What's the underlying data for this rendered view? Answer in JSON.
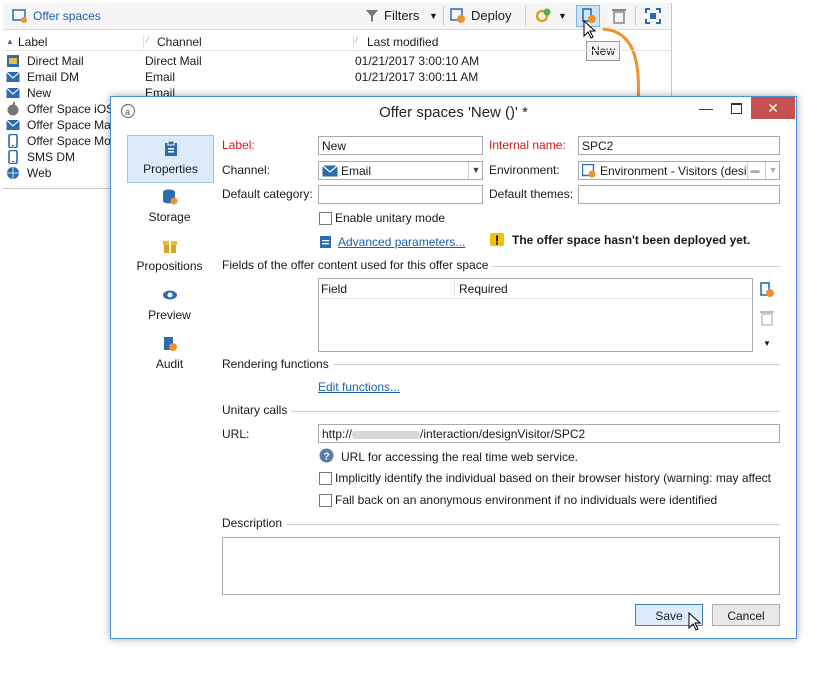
{
  "toolbar": {
    "title": "Offer spaces",
    "filters_label": "Filters",
    "deploy_label": "Deploy",
    "tooltip_new": "New"
  },
  "list": {
    "columns": [
      "Label",
      "Channel",
      "Last modified"
    ],
    "rows": [
      {
        "label": "Direct Mail",
        "channel": "Direct Mail",
        "modified": "01/21/2017 3:00:10 AM",
        "icon": "direct-mail-icon"
      },
      {
        "label": "Email DM",
        "channel": "Email",
        "modified": "01/21/2017 3:00:11 AM",
        "icon": "email-icon"
      },
      {
        "label": "New",
        "channel": "Email",
        "modified": "",
        "icon": "email-icon"
      },
      {
        "label": "Offer Space iOS",
        "channel": "",
        "modified": "",
        "icon": "apple-icon"
      },
      {
        "label": "Offer Space Mai",
        "channel": "",
        "modified": "",
        "icon": "email-icon"
      },
      {
        "label": "Offer Space Mo",
        "channel": "",
        "modified": "",
        "icon": "mobile-icon"
      },
      {
        "label": "SMS DM",
        "channel": "",
        "modified": "",
        "icon": "mobile-icon"
      },
      {
        "label": "Web",
        "channel": "",
        "modified": "",
        "icon": "globe-icon"
      }
    ]
  },
  "dialog": {
    "title": "Offer spaces 'New ()' *",
    "nav": [
      "Properties",
      "Storage",
      "Propositions",
      "Preview",
      "Audit"
    ],
    "label_label": "Label:",
    "label_value": "New",
    "internal_name_label": "Internal name:",
    "internal_name_value": "SPC2",
    "channel_label": "Channel:",
    "channel_value": "Email",
    "environment_label": "Environment:",
    "environment_value": "Environment - Visitors (desi",
    "default_category_label": "Default category:",
    "default_category_value": "",
    "default_themes_label": "Default themes:",
    "default_themes_value": "",
    "unitary_mode_label": "Enable unitary mode",
    "advanced_link": "Advanced parameters...",
    "warning_text": "The offer space hasn't been deployed yet.",
    "fields_section": "Fields of the offer content used for this offer space",
    "fields_columns": [
      "Field",
      "Required"
    ],
    "rendering_section": "Rendering functions",
    "edit_functions_link": "Edit functions...",
    "unitary_calls_section": "Unitary calls",
    "url_label": "URL:",
    "url_prefix": "http://",
    "url_suffix": "/interaction/designVisitor/SPC2",
    "url_help": "URL for accessing the real time web service.",
    "identify_label": "Implicitly identify the individual based on their browser history (warning: may affect",
    "fallback_label": "Fall back on an anonymous environment if no individuals were identified",
    "description_section": "Description",
    "description_value": "",
    "save_label": "Save",
    "cancel_label": "Cancel"
  },
  "colors": {
    "accent": "#1a5fb4",
    "required": "#cc1a1a",
    "arrow": "#f0922b",
    "close": "#c75050"
  }
}
